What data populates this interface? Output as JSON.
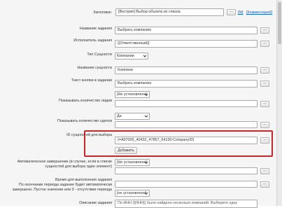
{
  "title_row": {
    "label": "Заголовок:",
    "value": "[Вестрие] Выбор объекта из списка",
    "modifier_link": "[M]",
    "comments_link": "[Комментарий]"
  },
  "fields": {
    "task_name": {
      "label": "Название задания",
      "value": "Выбрать компанию"
    },
    "executors": {
      "label": "Исполнитель задания",
      "value": "{{Ответственный}}"
    },
    "entity_type": {
      "label": "Тип Сущности",
      "value": "Компании"
    },
    "entity_name": {
      "label": "Названия сущности",
      "value": "Компани"
    },
    "button_text": {
      "label": "Текст кнопки в задании",
      "value": "Выбрать компанию"
    },
    "show_leads": {
      "label": "Показывать количество лидов",
      "value": "[Не установлено]"
    },
    "show_deals": {
      "label": "Показывать количество сделок",
      "value": "Да"
    },
    "entity_id": {
      "label": "ID сущностей для выбора",
      "value": "{=A97005_40432_47857_64130:CompanyID}",
      "add_button": "Добавить"
    },
    "auto_complete": {
      "label_line1": "Автоматическое завершение (в случае, если в списке",
      "label_line2": "сущностей для выбора один элемент)",
      "value": "[Не установлено]"
    },
    "time_limit": {
      "label_line1": "Время для выполнения задания",
      "label_line2": "По окончании периода задание будет автоматически",
      "label_line3": "завершено. Пустое значение или 0 - отсутствие периода",
      "value": "[не установлено]"
    },
    "description": {
      "label": "Описание задания",
      "value": "По ИНН {{ИНН}} было найдено несколько компаний. Выберите одну"
    }
  },
  "icons": {
    "dots_label": "..."
  }
}
